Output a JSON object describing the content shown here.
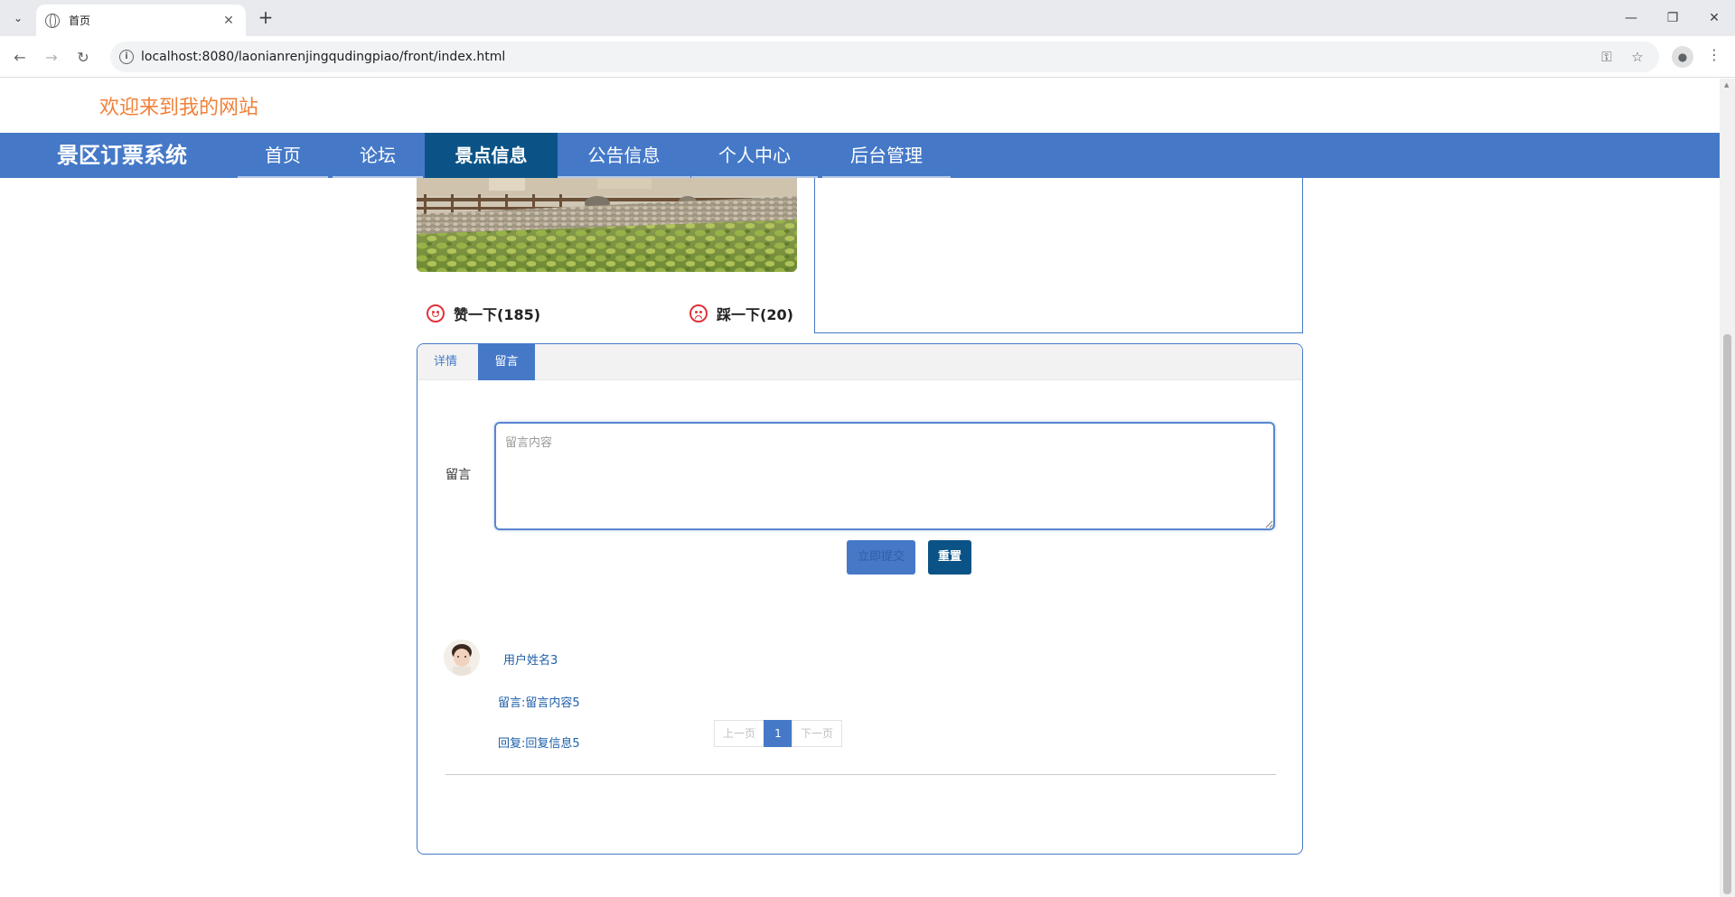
{
  "browser": {
    "tab_title": "首页",
    "url": "localhost:8080/laonianrenjingqudingpiao/front/index.html"
  },
  "site": {
    "welcome": "欢迎来到我的网站",
    "brand": "景区订票系统",
    "nav": [
      {
        "label": "首页",
        "active": false
      },
      {
        "label": "论坛",
        "active": false
      },
      {
        "label": "景点信息",
        "active": true
      },
      {
        "label": "公告信息",
        "active": false
      },
      {
        "label": "个人中心",
        "active": false
      },
      {
        "label": "后台管理",
        "active": false
      }
    ]
  },
  "votes": {
    "like_label": "赞一下(185)",
    "dislike_label": "踩一下(20)"
  },
  "comment_panel": {
    "tabs": [
      {
        "label": "详情",
        "active": false
      },
      {
        "label": "留言",
        "active": true
      }
    ],
    "form_label": "留言",
    "placeholder": "留言内容",
    "submit_label": "立即提交",
    "reset_label": "重置",
    "comments": [
      {
        "user": "用户姓名3",
        "message": "留言:留言内容5",
        "reply": "回复:回复信息5"
      }
    ],
    "pager": {
      "prev": "上一页",
      "current": "1",
      "next": "下一页"
    }
  },
  "colors": {
    "nav_bg": "#4579c8",
    "nav_active": "#0b5386",
    "welcome_text": "#f0813a"
  }
}
